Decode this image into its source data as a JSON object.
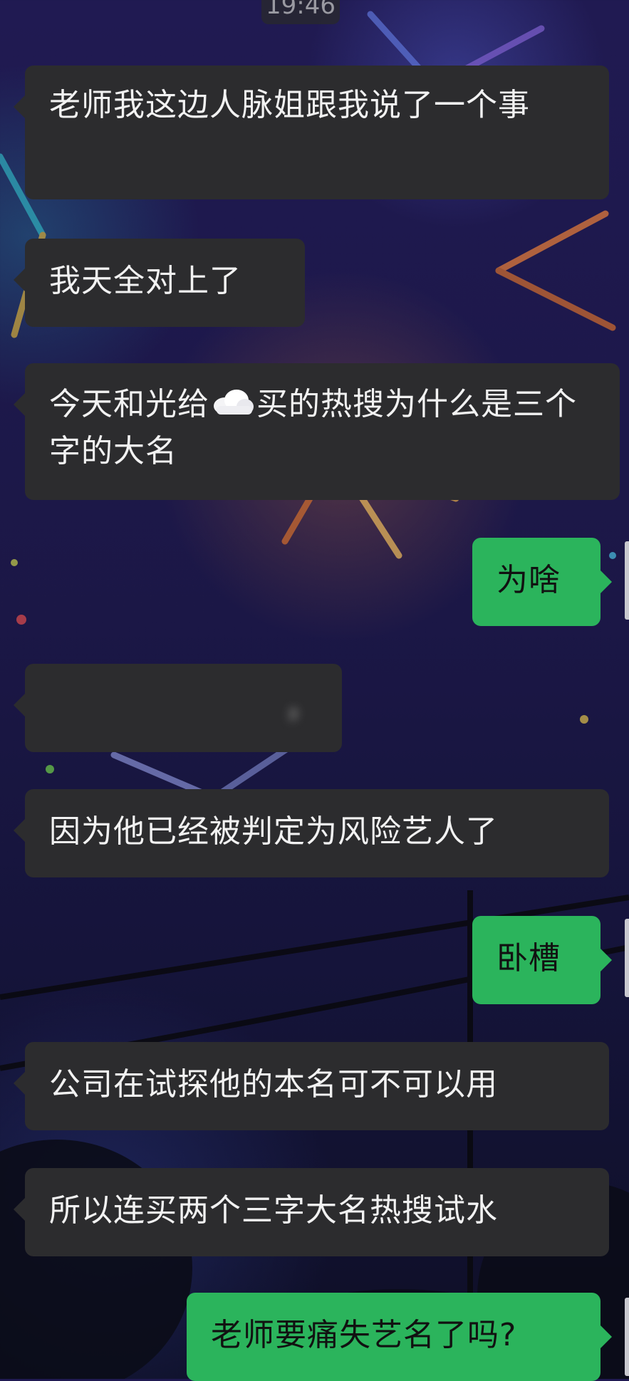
{
  "status": {
    "time": "19:46"
  },
  "messages": [
    {
      "side": "in",
      "text": "老师我这边人脉姐跟我说了一个事"
    },
    {
      "side": "in",
      "text": "我天全对上了"
    },
    {
      "side": "in",
      "text_before": "今天和光给",
      "emoji": "cloud",
      "text_after": "买的热搜为什么是三个字的大名"
    },
    {
      "side": "out",
      "text": "为啥"
    },
    {
      "side": "in",
      "text": "，",
      "note": "redacted"
    },
    {
      "side": "in",
      "text": "因为他已经被判定为风险艺人了"
    },
    {
      "side": "out",
      "text": "卧槽"
    },
    {
      "side": "in",
      "text": "公司在试探他的本名可不可以用"
    },
    {
      "side": "in",
      "text": "所以连买两个三字大名热搜试水"
    },
    {
      "side": "out",
      "text": "老师要痛失艺名了吗?"
    }
  ],
  "colors": {
    "incoming_bubble": "#2c2c2e",
    "outgoing_bubble": "#2bb45c"
  }
}
